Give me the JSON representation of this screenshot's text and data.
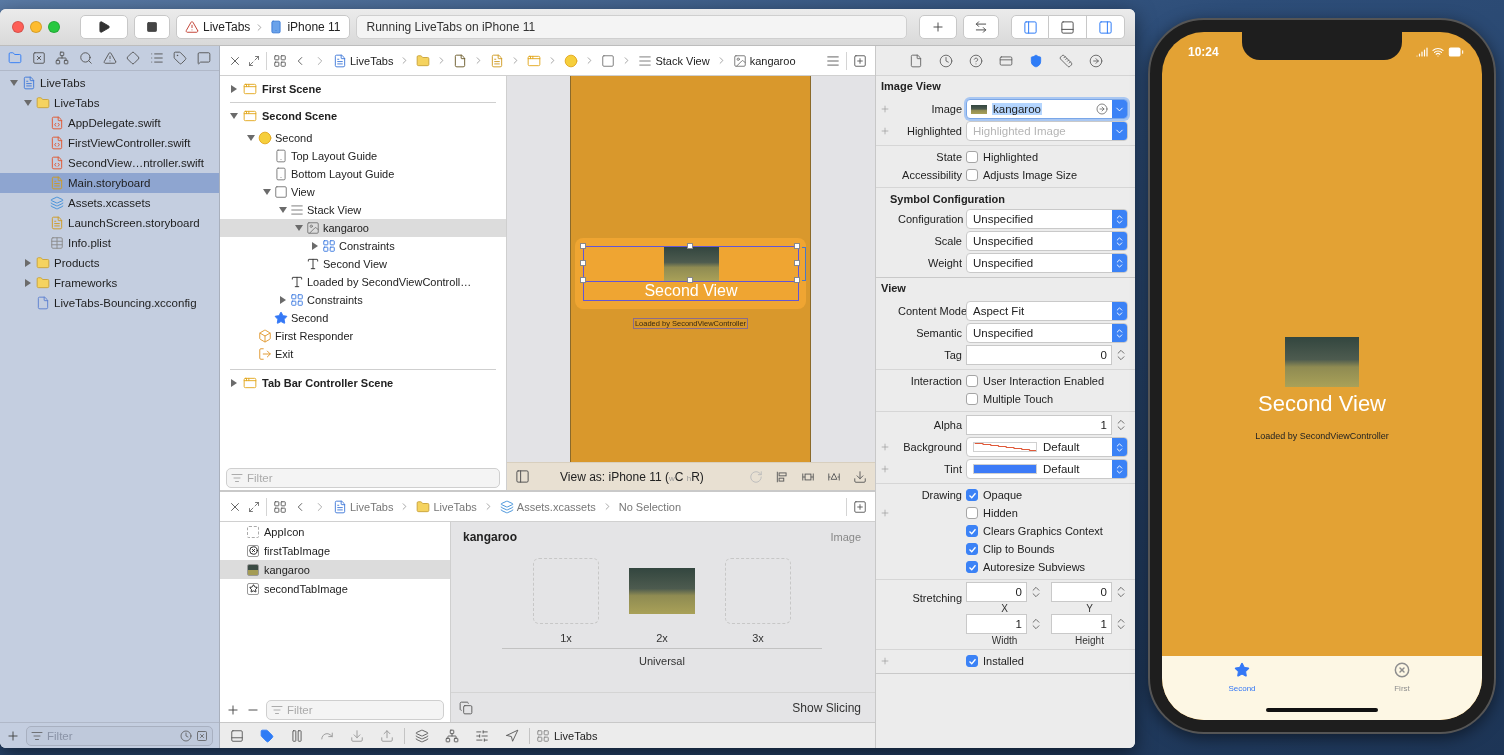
{
  "toolbar": {
    "scheme": "LiveTabs",
    "device": "iPhone 11",
    "activity": "Running LiveTabs on iPhone 11",
    "panels": [
      {
        "selected": true
      },
      {
        "selected": false
      },
      {
        "selected": true
      }
    ]
  },
  "navigator": {
    "tabs": [
      {
        "selected": true
      },
      {
        "selected": false
      },
      {
        "selected": false
      },
      {
        "selected": false
      },
      {
        "selected": false
      },
      {
        "selected": false
      },
      {
        "selected": false
      },
      {
        "selected": false
      },
      {
        "selected": false
      }
    ],
    "tree": [
      {
        "kind": "project",
        "label": "LiveTabs",
        "expanded": true,
        "selected": false,
        "children": [
          {
            "kind": "folder",
            "label": "LiveTabs",
            "expanded": true,
            "selected": false,
            "children": [
              {
                "kind": "swift",
                "label": "AppDelegate.swift",
                "selected": false
              },
              {
                "kind": "swift",
                "label": "FirstViewController.swift",
                "selected": false
              },
              {
                "kind": "swift",
                "label": "SecondView…ntroller.swift",
                "selected": false
              },
              {
                "kind": "storyboard",
                "label": "Main.storyboard",
                "selected": true
              },
              {
                "kind": "assets",
                "label": "Assets.xcassets",
                "selected": false
              },
              {
                "kind": "storyboard",
                "label": "LaunchScreen.storyboard",
                "selected": false
              },
              {
                "kind": "plist",
                "label": "Info.plist",
                "selected": false
              }
            ]
          },
          {
            "kind": "folder",
            "label": "Products",
            "expanded": false,
            "selected": false
          },
          {
            "kind": "folder",
            "label": "Frameworks",
            "expanded": false,
            "selected": false
          },
          {
            "kind": "config",
            "label": "LiveTabs-Bouncing.xcconfig",
            "selected": false
          }
        ]
      }
    ],
    "filter": {
      "placeholder": "Filter"
    }
  },
  "editor": {
    "jump_bar": [
      {
        "kind": "project",
        "label": "LiveTabs"
      },
      {
        "kind": "folder"
      },
      {
        "kind": "file"
      },
      {
        "kind": "storyboard"
      },
      {
        "kind": "scene"
      },
      {
        "kind": "controller"
      },
      {
        "kind": "view"
      },
      {
        "kind": "stack",
        "label": "Stack View"
      },
      {
        "kind": "image",
        "label": "kangaroo"
      }
    ],
    "outline": {
      "scenes": [
        {
          "label": "First Scene",
          "expanded": false
        },
        {
          "label": "Second Scene",
          "expanded": true,
          "children": [
            {
              "kind": "controller",
              "label": "Second",
              "expanded": true,
              "selected": false,
              "children": [
                {
                  "kind": "guide",
                  "label": "Top Layout Guide",
                  "selected": false
                },
                {
                  "kind": "guide",
                  "label": "Bottom Layout Guide",
                  "selected": false
                },
                {
                  "kind": "view",
                  "label": "View",
                  "expanded": true,
                  "selected": false,
                  "children": [
                    {
                      "kind": "stack",
                      "label": "Stack View",
                      "expanded": true,
                      "selected": false,
                      "children": [
                        {
                          "kind": "image",
                          "label": "kangaroo",
                          "expanded": true,
                          "selected": true,
                          "children": [
                            {
                              "kind": "constraints",
                              "label": "Constraints",
                              "expanded": false,
                              "selected": false
                            }
                          ]
                        },
                        {
                          "kind": "label",
                          "label": "Second View",
                          "selected": false
                        }
                      ]
                    },
                    {
                      "kind": "label",
                      "label": "Loaded by SecondViewControll…",
                      "selected": false
                    },
                    {
                      "kind": "constraints",
                      "label": "Constraints",
                      "expanded": false,
                      "selected": false
                    }
                  ]
                },
                {
                  "kind": "tabitem",
                  "label": "Second",
                  "selected": false
                }
              ]
            },
            {
              "kind": "responder",
              "label": "First Responder",
              "selected": false
            },
            {
              "kind": "exit",
              "label": "Exit",
              "selected": false
            }
          ]
        },
        {
          "label": "Tab Bar Controller Scene",
          "expanded": false
        }
      ],
      "filter": {
        "placeholder": "Filter"
      }
    },
    "canvas": {
      "title": "Second View",
      "subtitle": "Loaded by SecondViewController",
      "view_as": "View as: iPhone 11 ($_{w}$C $_{h}$R)"
    },
    "assets_jump_bar": [
      {
        "kind": "project",
        "label": "LiveTabs"
      },
      {
        "kind": "folder",
        "label": "LiveTabs"
      },
      {
        "kind": "assets",
        "label": "Assets.xcassets"
      },
      {
        "kind": "none",
        "label": "No Selection"
      }
    ],
    "assets": {
      "items": [
        {
          "kind": "appicon",
          "label": "AppIcon",
          "selected": false
        },
        {
          "kind": "circle",
          "label": "firstTabImage",
          "selected": false
        },
        {
          "kind": "photo",
          "label": "kangaroo",
          "selected": true
        },
        {
          "kind": "star",
          "label": "secondTabImage",
          "selected": false
        }
      ],
      "filter": {
        "placeholder": "Filter"
      },
      "detail": {
        "name": "kangaroo",
        "type": "Image",
        "slots": [
          {
            "label": "1x",
            "filled": false
          },
          {
            "label": "2x",
            "filled": true
          },
          {
            "label": "3x",
            "filled": false
          }
        ],
        "group": "Universal",
        "slicing": "Show Slicing"
      }
    },
    "debug_bar": {
      "target": "LiveTabs"
    }
  },
  "inspector": {
    "tabs": [
      {
        "selected": false
      },
      {
        "selected": false
      },
      {
        "selected": false
      },
      {
        "selected": false
      },
      {
        "selected": true
      },
      {
        "selected": false
      },
      {
        "selected": false
      }
    ],
    "sections": [
      {
        "title": "Image View",
        "groups": [
          {
            "rows": [
              {
                "kind": "image-combo",
                "plus": true,
                "label": "Image",
                "value": "kangaroo"
              },
              {
                "kind": "combo",
                "plus": true,
                "label": "Highlighted",
                "placeholder": "Highlighted Image"
              }
            ]
          },
          {
            "rows": [
              {
                "kind": "checkbox",
                "plus": false,
                "label": "State",
                "text": "Highlighted",
                "checked": false
              },
              {
                "kind": "checkbox",
                "plus": false,
                "label": "Accessibility",
                "text": "Adjusts Image Size",
                "checked": false
              }
            ]
          },
          {
            "heading": "Symbol Configuration",
            "rows": [
              {
                "kind": "popup",
                "plus": false,
                "label": "Configuration",
                "value": "Unspecified"
              },
              {
                "kind": "popup",
                "plus": false,
                "label": "Scale",
                "value": "Unspecified"
              },
              {
                "kind": "popup",
                "plus": false,
                "label": "Weight",
                "value": "Unspecified"
              }
            ]
          }
        ]
      },
      {
        "title": "View",
        "groups": [
          {
            "rows": [
              {
                "kind": "popup",
                "plus": false,
                "label": "Content Mode",
                "value": "Aspect Fit"
              },
              {
                "kind": "popup",
                "plus": false,
                "label": "Semantic",
                "value": "Unspecified"
              },
              {
                "kind": "number",
                "plus": false,
                "label": "Tag",
                "value": "0"
              }
            ]
          },
          {
            "rows": [
              {
                "kind": "checkbox",
                "plus": false,
                "label": "Interaction",
                "text": "User Interaction Enabled",
                "checked": false
              },
              {
                "kind": "checkbox",
                "plus": false,
                "text": "Multiple Touch",
                "checked": false
              }
            ]
          },
          {
            "rows": [
              {
                "kind": "number",
                "plus": false,
                "label": "Alpha",
                "value": "1"
              },
              {
                "kind": "color",
                "plus": true,
                "label": "Background",
                "value": "Default"
              },
              {
                "kind": "color",
                "plus": true,
                "label": "Tint",
                "value": "Default",
                "color": "#3d7bf7"
              }
            ]
          },
          {
            "rows": [
              {
                "kind": "checkbox",
                "plus": false,
                "label": "Drawing",
                "text": "Opaque",
                "checked": true
              },
              {
                "kind": "checkbox",
                "plus": true,
                "text": "Hidden",
                "checked": false
              },
              {
                "kind": "checkbox",
                "plus": false,
                "text": "Clears Graphics Context",
                "checked": true
              },
              {
                "kind": "checkbox",
                "plus": false,
                "text": "Clip to Bounds",
                "checked": true
              },
              {
                "kind": "checkbox",
                "plus": false,
                "text": "Autoresize Subviews",
                "checked": true
              }
            ]
          },
          {
            "rows": [
              {
                "kind": "pair",
                "plus": false,
                "label": "Stretching",
                "fields": [
                  {
                    "value": "0",
                    "caption": "X"
                  },
                  {
                    "value": "0",
                    "caption": "Y"
                  }
                ]
              },
              {
                "kind": "pair",
                "plus": false,
                "fields": [
                  {
                    "value": "1",
                    "caption": "Width"
                  },
                  {
                    "value": "1",
                    "caption": "Height"
                  }
                ]
              }
            ]
          },
          {
            "rows": [
              {
                "kind": "checkbox",
                "plus": true,
                "text": "Installed",
                "checked": true
              }
            ]
          }
        ]
      }
    ]
  },
  "simulator": {
    "time": "10:24",
    "title": "Second View",
    "subtitle": "Loaded by SecondViewController",
    "tabs": [
      {
        "label": "Second",
        "selected": true
      },
      {
        "label": "First",
        "selected": false
      }
    ]
  }
}
